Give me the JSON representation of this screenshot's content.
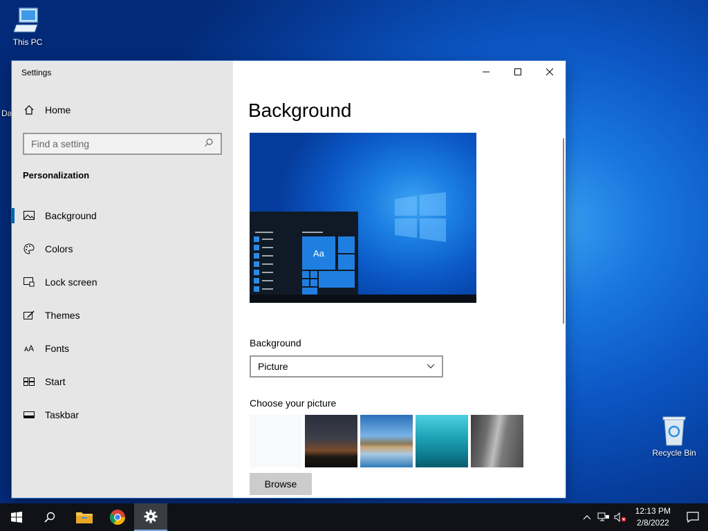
{
  "desktop": {
    "this_pc_label": "This PC",
    "recycle_bin_label": "Recycle Bin",
    "peek_text": "Da"
  },
  "window": {
    "title": "Settings",
    "controls": {
      "minimize": "minimize-icon",
      "maximize": "maximize-icon",
      "close": "close-icon"
    }
  },
  "sidebar": {
    "home_label": "Home",
    "search_placeholder": "Find a setting",
    "section_heading": "Personalization",
    "items": [
      {
        "label": "Background",
        "icon": "image-icon",
        "active": true
      },
      {
        "label": "Colors",
        "icon": "palette-icon",
        "active": false
      },
      {
        "label": "Lock screen",
        "icon": "lock-screen-icon",
        "active": false
      },
      {
        "label": "Themes",
        "icon": "themes-icon",
        "active": false
      },
      {
        "label": "Fonts",
        "icon": "fonts-icon",
        "active": false
      },
      {
        "label": "Start",
        "icon": "start-icon",
        "active": false
      },
      {
        "label": "Taskbar",
        "icon": "taskbar-icon",
        "active": false
      }
    ]
  },
  "content": {
    "page_title": "Background",
    "preview_tile_text": "Aa",
    "background_label": "Background",
    "background_value": "Picture",
    "choose_picture_label": "Choose your picture",
    "pictures": [
      "blank-white",
      "night-sky-tent",
      "beach-rocks",
      "underwater-swimmer",
      "cliff-face"
    ],
    "browse_label": "Browse"
  },
  "taskbar": {
    "apps": [
      "start-icon",
      "search-icon",
      "file-explorer-icon",
      "chrome-icon",
      "settings-icon"
    ],
    "active_app": "settings-icon",
    "time": "12:13 PM",
    "date": "2/8/2022"
  },
  "colors": {
    "accent": "#0063b1",
    "sidebar_bg": "#e6e6e6",
    "taskbar_bg": "#101217"
  }
}
